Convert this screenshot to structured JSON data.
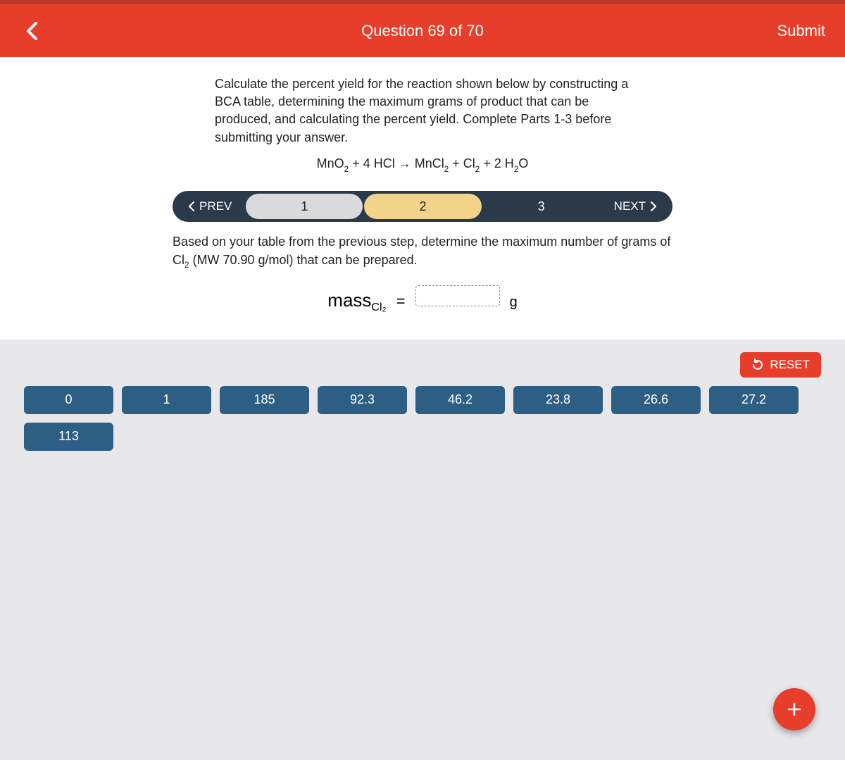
{
  "header": {
    "title": "Question 69 of 70",
    "submit": "Submit"
  },
  "prompt": "Calculate the percent yield for the reaction shown below by constructing a BCA table, determining the maximum grams of product that can be produced, and calculating the percent yield. Complete Parts 1-3 before submitting your answer.",
  "equation": {
    "lhs1": "MnO",
    "lhs1_sub": "2",
    "plus1": " + 4 HCl → ",
    "rhs1": "MnCl",
    "rhs1_sub": "2",
    "plus2": " + Cl",
    "rhs2_sub": "2",
    "plus3": " + 2 H",
    "rhs3_sub": "2",
    "tail": "O"
  },
  "stepper": {
    "prev": "PREV",
    "next": "NEXT",
    "steps": [
      "1",
      "2",
      "3"
    ],
    "active_index": 1
  },
  "instruction_a": "Based on your table from the previous step, determine the maximum number of grams of Cl",
  "instruction_sub": "2",
  "instruction_b": " (MW 70.90 g/mol) that can be prepared.",
  "mass": {
    "label": "mass",
    "label_sub": "Cl₂",
    "equals": "=",
    "unit": "g"
  },
  "reset": "RESET",
  "tiles": [
    "0",
    "1",
    "185",
    "92.3",
    "46.2",
    "23.8",
    "26.6",
    "27.2",
    "113"
  ]
}
